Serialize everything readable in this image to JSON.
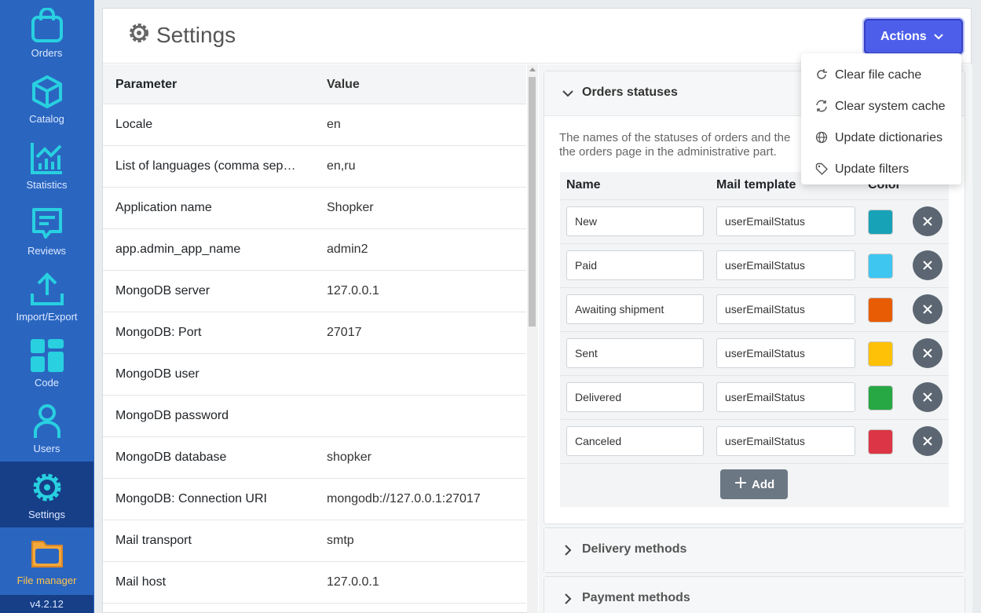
{
  "sidebar": {
    "items": [
      {
        "label": "Orders",
        "icon": "bag-icon"
      },
      {
        "label": "Catalog",
        "icon": "box-icon"
      },
      {
        "label": "Statistics",
        "icon": "chart-icon"
      },
      {
        "label": "Reviews",
        "icon": "message-icon"
      },
      {
        "label": "Import/Export",
        "icon": "upload-icon"
      },
      {
        "label": "Code",
        "icon": "grid-icon"
      },
      {
        "label": "Users",
        "icon": "user-icon"
      },
      {
        "label": "Settings",
        "icon": "gear-icon"
      },
      {
        "label": "File manager",
        "icon": "folder-icon"
      }
    ],
    "active": "Settings",
    "version": "v4.2.12"
  },
  "header": {
    "title": "Settings",
    "actions_label": "Actions"
  },
  "actions_menu": [
    {
      "label": "Clear file cache",
      "icon": "refresh-icon"
    },
    {
      "label": "Clear system cache",
      "icon": "sync-icon"
    },
    {
      "label": "Update dictionaries",
      "icon": "globe-icon"
    },
    {
      "label": "Update filters",
      "icon": "tag-icon"
    }
  ],
  "params": {
    "headers": {
      "parameter": "Parameter",
      "value": "Value"
    },
    "rows": [
      {
        "parameter": "Locale",
        "value": "en"
      },
      {
        "parameter": "List of languages (comma sep…",
        "value": "en,ru"
      },
      {
        "parameter": "Application name",
        "value": "Shopker"
      },
      {
        "parameter": "app.admin_app_name",
        "value": "admin2"
      },
      {
        "parameter": "MongoDB server",
        "value": "127.0.0.1"
      },
      {
        "parameter": "MongoDB: Port",
        "value": "27017"
      },
      {
        "parameter": "MongoDB user",
        "value": ""
      },
      {
        "parameter": "MongoDB password",
        "value": ""
      },
      {
        "parameter": "MongoDB database",
        "value": "shopker"
      },
      {
        "parameter": "MongoDB: Connection URI",
        "value": "mongodb://127.0.0.1:27017"
      },
      {
        "parameter": "Mail transport",
        "value": "smtp"
      },
      {
        "parameter": "Mail host",
        "value": "127.0.0.1"
      }
    ]
  },
  "orders_statuses": {
    "title": "Orders statuses",
    "description_line1": "The names of the statuses of orders and the",
    "description_line2": "the orders page in the administrative part.",
    "headers": {
      "name": "Name",
      "mail_template": "Mail template",
      "color": "Color"
    },
    "rows": [
      {
        "name": "New",
        "mail_template": "userEmailStatus",
        "color": "#17a2b8"
      },
      {
        "name": "Paid",
        "mail_template": "userEmailStatus",
        "color": "#3ec6f0"
      },
      {
        "name": "Awaiting shipment",
        "mail_template": "userEmailStatus",
        "color": "#e85d04"
      },
      {
        "name": "Sent",
        "mail_template": "userEmailStatus",
        "color": "#ffc107"
      },
      {
        "name": "Delivered",
        "mail_template": "userEmailStatus",
        "color": "#28a745"
      },
      {
        "name": "Canceled",
        "mail_template": "userEmailStatus",
        "color": "#dc3545"
      }
    ],
    "add_label": "Add"
  },
  "sections": {
    "delivery": "Delivery methods",
    "payment": "Payment methods"
  },
  "colors": {
    "sidebar": "#2a66c0",
    "sidebar_active": "#163f88",
    "icon_accent": "#28d0e0",
    "primary": "#4d5eea"
  }
}
